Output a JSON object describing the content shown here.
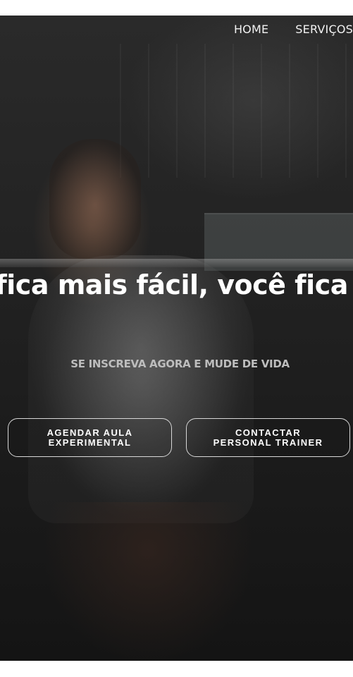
{
  "nav": {
    "items": [
      {
        "label": "HOME"
      },
      {
        "label": "SERVIÇOS"
      }
    ]
  },
  "hero": {
    "headline": "ar não fica mais fácil, você fica melhor",
    "subtitle": "SE INSCREVA AGORA E MUDE DE VIDA",
    "buttons": [
      {
        "label": "AGENDAR AULA EXPERIMENTAL"
      },
      {
        "label": "CONTACTAR PERSONAL TRAINER"
      }
    ]
  },
  "colors": {
    "page_background": "#ffffff",
    "hero_overlay": "#1f1f1f",
    "headline_text": "#ffffff",
    "subtitle_text": "#bdbdbd",
    "button_border": "#d8d8d8"
  }
}
